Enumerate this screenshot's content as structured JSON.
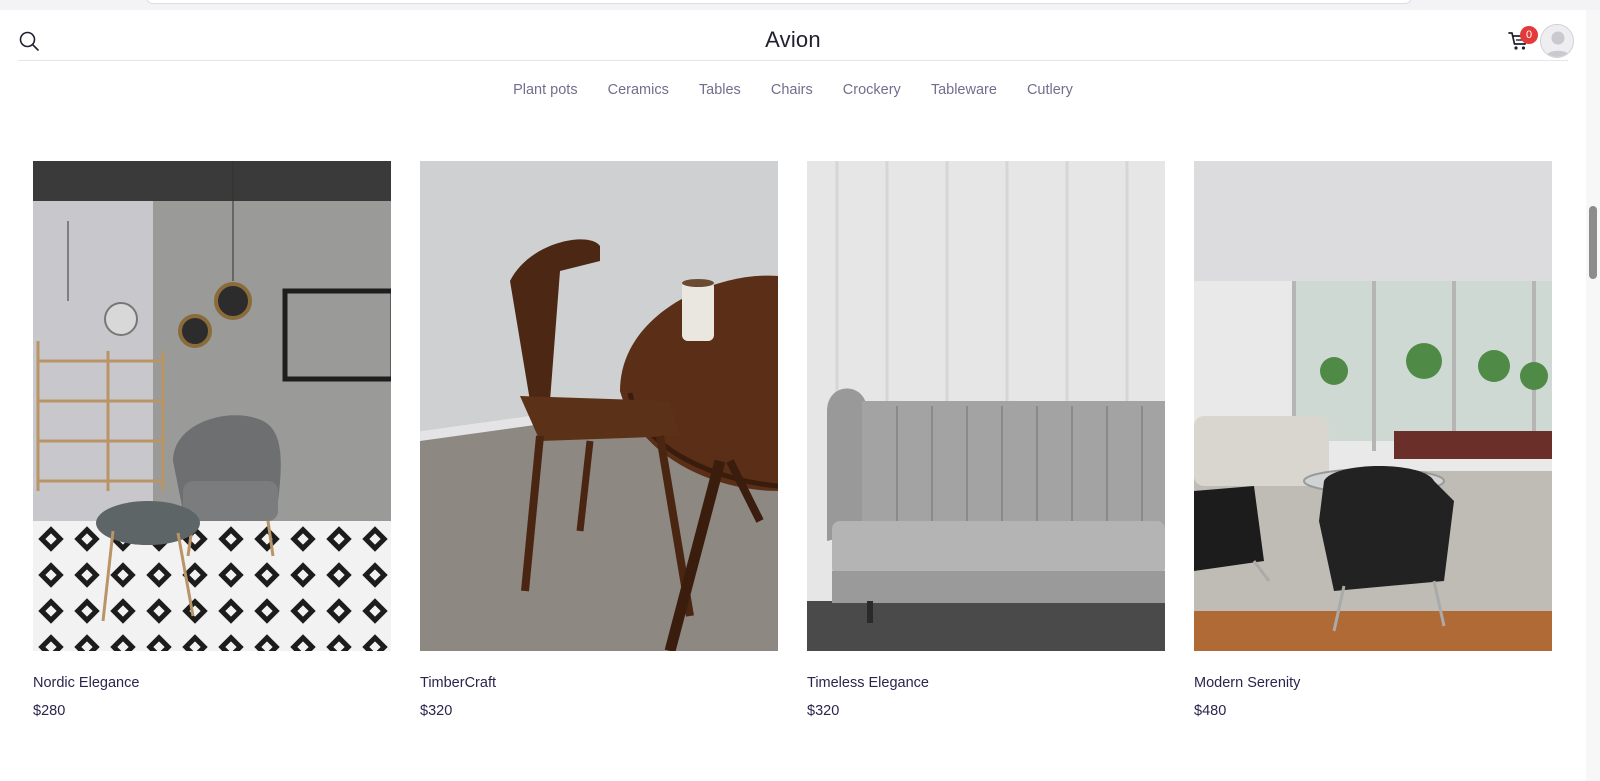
{
  "header": {
    "brand": "Avion",
    "cart_count": "0",
    "icons": {
      "search": "search-icon",
      "cart": "cart-icon",
      "avatar": "user-avatar"
    }
  },
  "nav": {
    "items": [
      "Plant pots",
      "Ceramics",
      "Tables",
      "Chairs",
      "Crockery",
      "Tableware",
      "Cutlery"
    ]
  },
  "products": [
    {
      "name": "Nordic Elegance",
      "price": "$280"
    },
    {
      "name": "TimberCraft",
      "price": "$320"
    },
    {
      "name": "Timeless Elegance",
      "price": "$320"
    },
    {
      "name": "Modern Serenity",
      "price": "$480"
    }
  ],
  "colors": {
    "text_primary": "#2a254b",
    "text_muted": "#726e8d",
    "badge": "#e23b3b"
  }
}
